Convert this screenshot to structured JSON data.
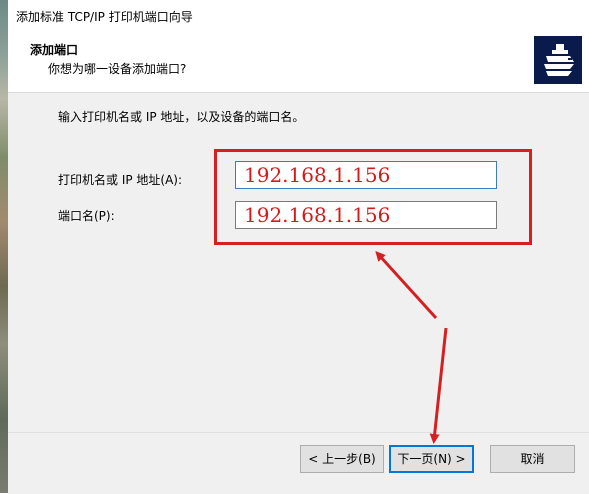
{
  "window": {
    "title": "添加标准 TCP/IP 打印机端口向导"
  },
  "header": {
    "title": "添加端口",
    "subtitle": "你想为哪一设备添加端口?",
    "icon": "printer-network-icon"
  },
  "form": {
    "instruction": "输入打印机名或 IP 地址，以及设备的端口名。",
    "printer_label": "打印机名或 IP 地址(A):",
    "printer_value": "192.168.1.156",
    "port_label": "端口名(P):",
    "port_value": "192.168.1.156"
  },
  "buttons": {
    "back": "< 上一步(B)",
    "next": "下一页(N) >",
    "cancel": "取消"
  },
  "colors": {
    "annotation_red": "#d42020",
    "value_text_red": "#d51a1a",
    "icon_bg": "#0a1a4a"
  }
}
